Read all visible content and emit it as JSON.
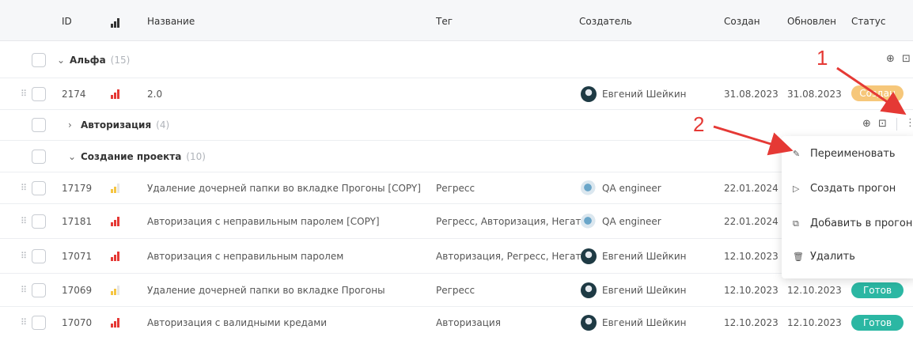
{
  "header": {
    "id": "ID",
    "name": "Название",
    "tag": "Тег",
    "creator": "Создатель",
    "created": "Создан",
    "updated": "Обновлен",
    "status": "Статус"
  },
  "groups": {
    "alpha": {
      "name": "Альфа",
      "count": "(15)"
    },
    "auth": {
      "name": "Авторизация",
      "count": "(4)"
    },
    "project": {
      "name": "Создание проекта",
      "count": "(10)"
    }
  },
  "rows": [
    {
      "id": "2174",
      "name": "2.0",
      "tag": "",
      "creator": "Евгений Шейкин",
      "created": "31.08.2023",
      "updated": "31.08.2023",
      "status": "Создан"
    },
    {
      "id": "17179",
      "name": "Удаление дочерней папки во вкладке Прогоны [COPY]",
      "tag": "Регресс",
      "creator": "QA engineer",
      "created": "22.01.2024",
      "updated": "",
      "status": ""
    },
    {
      "id": "17181",
      "name": "Авторизация с неправильным паролем [COPY]",
      "tag": "Регресс, Авторизация, Негат...",
      "creator": "QA engineer",
      "created": "22.01.2024",
      "updated": "",
      "status": ""
    },
    {
      "id": "17071",
      "name": "Авторизация с неправильным паролем",
      "tag": "Авторизация, Регресс, Негат...",
      "creator": "Евгений Шейкин",
      "created": "12.10.2023",
      "updated": "",
      "status": ""
    },
    {
      "id": "17069",
      "name": "Удаление дочерней папки во вкладке Прогоны",
      "tag": "Регресс",
      "creator": "Евгений Шейкин",
      "created": "12.10.2023",
      "updated": "12.10.2023",
      "status": "Готов"
    },
    {
      "id": "17070",
      "name": "Авторизация с валидными кредами",
      "tag": "Авторизация",
      "creator": "Евгений Шейкин",
      "created": "12.10.2023",
      "updated": "12.10.2023",
      "status": "Готов"
    }
  ],
  "menu": {
    "rename": "Переименовать",
    "create_run": "Создать прогон",
    "add_to_run": "Добавить в прогон",
    "delete": "Удалить"
  },
  "annotations": {
    "one": "1",
    "two": "2"
  },
  "colors": {
    "priority_high": "#e53935",
    "priority_low": "#f5c542",
    "status_created": "#f6c77a",
    "status_ready": "#2bb7a3",
    "annotation": "#e53935"
  },
  "icons": [
    "priority-icon",
    "chevron-down-icon",
    "chevron-right-icon",
    "drag-handle-icon",
    "add-circle-icon",
    "add-folder-icon",
    "more-icon",
    "edit-icon",
    "play-icon",
    "add-to-run-icon",
    "trash-icon"
  ]
}
